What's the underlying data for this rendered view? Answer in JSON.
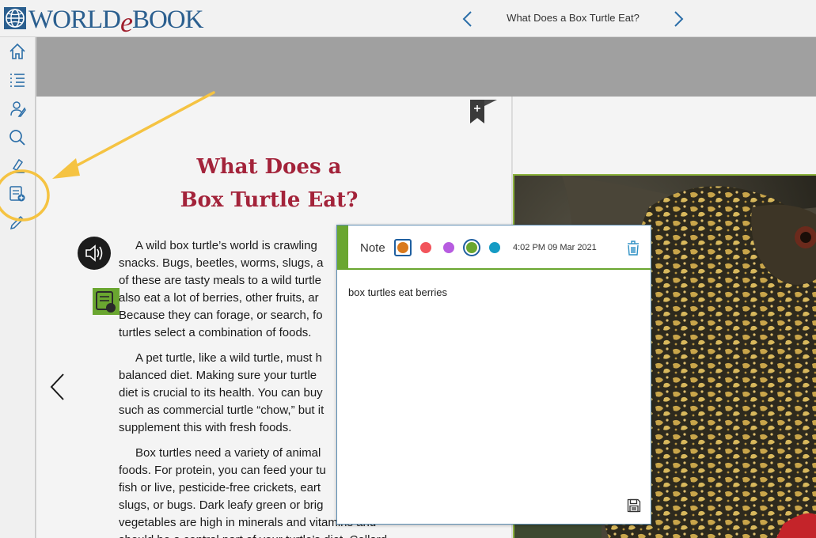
{
  "app": {
    "logo_text_a": "WORLD",
    "logo_text_e": "e",
    "logo_text_b": "BOOK"
  },
  "header": {
    "title": "What Does a Box Turtle Eat?"
  },
  "sidebar": {
    "items": [
      {
        "icon": "home-icon"
      },
      {
        "icon": "table-of-contents-icon"
      },
      {
        "icon": "activities-icon"
      },
      {
        "icon": "search-icon"
      },
      {
        "icon": "highlight-icon"
      },
      {
        "icon": "add-note-icon"
      },
      {
        "icon": "edit-icon"
      }
    ]
  },
  "page": {
    "title_line1": "What Does a",
    "title_line2": "Box Turtle Eat?",
    "paragraphs": [
      [
        "A wild box turtle’s world is crawling",
        "snacks. Bugs, beetles, worms, slugs, a",
        "of these are tasty meals to a wild turtle",
        "also eat a lot of berries, other fruits, ar",
        "Because they can forage, or search, fo",
        "turtles select a combination of foods."
      ],
      [
        "A pet turtle, like a wild turtle, must h",
        "balanced diet. Making sure your turtle",
        "diet is crucial to its health. You can buy",
        "such as commercial turtle “chow,” but it",
        "supplement this with fresh foods."
      ],
      [
        "Box turtles need a variety of animal",
        "foods. For protein, you can feed your tu",
        "fish or live, pesticide-free crickets, eart",
        "slugs, or bugs. Dark leafy green or brig",
        "vegetables are high in minerals and vitamins and",
        "should be a central part of your turtle’s diet. Collard"
      ]
    ]
  },
  "note": {
    "label": "Note",
    "timestamp": "4:02 PM 09 Mar 2021",
    "text": "box turtles eat berries",
    "colors": [
      "#d9791d",
      "#f2545b",
      "#b75ce0",
      "#6aa630",
      "#159bc4"
    ],
    "selected_color_index": 3
  },
  "theme": {
    "accent": "#6aa630",
    "title_color": "#a3233a",
    "link_blue": "#2b6ea8",
    "annotation": "#f5c342"
  }
}
